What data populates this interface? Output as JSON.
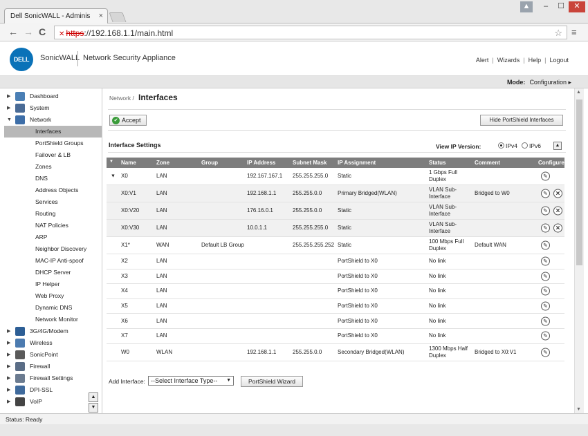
{
  "browser": {
    "tab_title": "Dell SonicWALL - Adminis",
    "tab_close": "×",
    "url_scheme": "https",
    "url_rest": "://192.168.1.1/main.html",
    "win_user": "▲",
    "win_min": "–",
    "win_max": "☐",
    "win_close": "✕",
    "back": "←",
    "forward": "→",
    "reload": "C",
    "star": "☆",
    "menu": "≡",
    "lock_icon": "✕"
  },
  "header": {
    "logo_text": "DELL",
    "brand": "SonicWALL",
    "product": "Network Security Appliance",
    "links": [
      "Alert",
      "Wizards",
      "Help",
      "Logout"
    ],
    "link_sep": "|"
  },
  "modebar": {
    "mode_label": "Mode:",
    "mode_value": "Configuration ▸"
  },
  "sidebar": {
    "top_items": [
      {
        "label": "Dashboard",
        "arrow": "▶",
        "icon": "dashboard-icon",
        "color": "#4a7fb5"
      },
      {
        "label": "System",
        "arrow": "▶",
        "icon": "system-icon",
        "color": "#4a6b96"
      },
      {
        "label": "Network",
        "arrow": "▼",
        "icon": "network-icon",
        "color": "#3d6ea8"
      }
    ],
    "sub_items": [
      "Interfaces",
      "PortShield Groups",
      "Failover & LB",
      "Zones",
      "DNS",
      "Address Objects",
      "Services",
      "Routing",
      "NAT Policies",
      "ARP",
      "Neighbor Discovery",
      "MAC-IP Anti-spoof",
      "DHCP Server",
      "IP Helper",
      "Web Proxy",
      "Dynamic DNS",
      "Network Monitor"
    ],
    "active_sub": "Interfaces",
    "bottom_items": [
      {
        "label": "3G/4G/Modem",
        "arrow": "▶",
        "icon": "modem-icon",
        "color": "#2d5e95"
      },
      {
        "label": "Wireless",
        "arrow": "▶",
        "icon": "wireless-icon",
        "color": "#4c7bb0"
      },
      {
        "label": "SonicPoint",
        "arrow": "▶",
        "icon": "sonicpoint-icon",
        "color": "#5a5a5a"
      },
      {
        "label": "Firewall",
        "arrow": "▶",
        "icon": "firewall-icon",
        "color": "#5a6d86"
      },
      {
        "label": "Firewall Settings",
        "arrow": "▶",
        "icon": "firewall-settings-icon",
        "color": "#6b7b90"
      },
      {
        "label": "DPI-SSL",
        "arrow": "▶",
        "icon": "dpi-ssl-icon",
        "color": "#3f6a9c"
      },
      {
        "label": "VoIP",
        "arrow": "▶",
        "icon": "voip-icon",
        "color": "#444444"
      }
    ],
    "scroll_up": "▲",
    "scroll_down": "▼"
  },
  "main": {
    "breadcrumb": "Network /",
    "title": "Interfaces",
    "accept_label": "Accept",
    "accept_icon": "✔",
    "hide_portshield_label": "Hide PortShield Interfaces",
    "section_title": "Interface Settings",
    "ip_version_label": "View IP Version:",
    "ipv4_label": "IPv4",
    "ipv6_label": "IPv6",
    "ip_version_selected": "IPv4",
    "collapse_icon": "▲",
    "columns": [
      "Name",
      "Zone",
      "Group",
      "IP Address",
      "Subnet Mask",
      "IP Assignment",
      "Status",
      "Comment",
      "Configure"
    ],
    "header_tri": "▼",
    "rows": [
      {
        "expand": "▼",
        "name": "X0",
        "zone": "LAN",
        "group": "",
        "ip": "192.167.167.1",
        "mask": "255.255.255.0",
        "assign": "Static",
        "status": "1 Gbps Full Duplex",
        "comment": "",
        "delete": false,
        "sub": false
      },
      {
        "expand": "",
        "name": "X0:V1",
        "zone": "LAN",
        "group": "",
        "ip": "192.168.1.1",
        "mask": "255.255.0.0",
        "assign": "Primary Bridged(WLAN)",
        "status": "VLAN Sub-Interface",
        "comment": "Bridged to W0",
        "delete": true,
        "sub": true
      },
      {
        "expand": "",
        "name": "X0:V20",
        "zone": "LAN",
        "group": "",
        "ip": "176.16.0.1",
        "mask": "255.255.0.0",
        "assign": "Static",
        "status": "VLAN Sub-Interface",
        "comment": "",
        "delete": true,
        "sub": true
      },
      {
        "expand": "",
        "name": "X0:V30",
        "zone": "LAN",
        "group": "",
        "ip": "10.0.1.1",
        "mask": "255.255.255.0",
        "assign": "Static",
        "status": "VLAN Sub-Interface",
        "comment": "",
        "delete": true,
        "sub": true
      },
      {
        "expand": "",
        "name": "X1*",
        "zone": "WAN",
        "group": "Default LB Group",
        "ip": "",
        "mask": "255.255.255.252",
        "assign": "Static",
        "status": "100 Mbps Full Duplex",
        "comment": "Default WAN",
        "delete": false,
        "sub": false
      },
      {
        "expand": "",
        "name": "X2",
        "zone": "LAN",
        "group": "",
        "ip": "",
        "mask": "",
        "assign": "PortShield to X0",
        "status": "No link",
        "comment": "",
        "delete": false,
        "sub": false
      },
      {
        "expand": "",
        "name": "X3",
        "zone": "LAN",
        "group": "",
        "ip": "",
        "mask": "",
        "assign": "PortShield to X0",
        "status": "No link",
        "comment": "",
        "delete": false,
        "sub": false
      },
      {
        "expand": "",
        "name": "X4",
        "zone": "LAN",
        "group": "",
        "ip": "",
        "mask": "",
        "assign": "PortShield to X0",
        "status": "No link",
        "comment": "",
        "delete": false,
        "sub": false
      },
      {
        "expand": "",
        "name": "X5",
        "zone": "LAN",
        "group": "",
        "ip": "",
        "mask": "",
        "assign": "PortShield to X0",
        "status": "No link",
        "comment": "",
        "delete": false,
        "sub": false
      },
      {
        "expand": "",
        "name": "X6",
        "zone": "LAN",
        "group": "",
        "ip": "",
        "mask": "",
        "assign": "PortShield to X0",
        "status": "No link",
        "comment": "",
        "delete": false,
        "sub": false
      },
      {
        "expand": "",
        "name": "X7",
        "zone": "LAN",
        "group": "",
        "ip": "",
        "mask": "",
        "assign": "PortShield to X0",
        "status": "No link",
        "comment": "",
        "delete": false,
        "sub": false
      },
      {
        "expand": "",
        "name": "W0",
        "zone": "WLAN",
        "group": "",
        "ip": "192.168.1.1",
        "mask": "255.255.0.0",
        "assign": "Secondary Bridged(WLAN)",
        "status": "1300 Mbps Half Duplex",
        "comment": "Bridged to X0:V1",
        "delete": false,
        "sub": false
      }
    ],
    "configure_icon": "✎",
    "delete_icon": "✕",
    "add_interface_label": "Add Interface:",
    "add_interface_value": "--Select Interface Type--",
    "dropdown_icon": "▼",
    "portshield_wizard_label": "PortShield Wizard"
  },
  "scrollbar": {
    "up": "▲",
    "down": "▼"
  },
  "status": {
    "text": "Status: Ready"
  }
}
